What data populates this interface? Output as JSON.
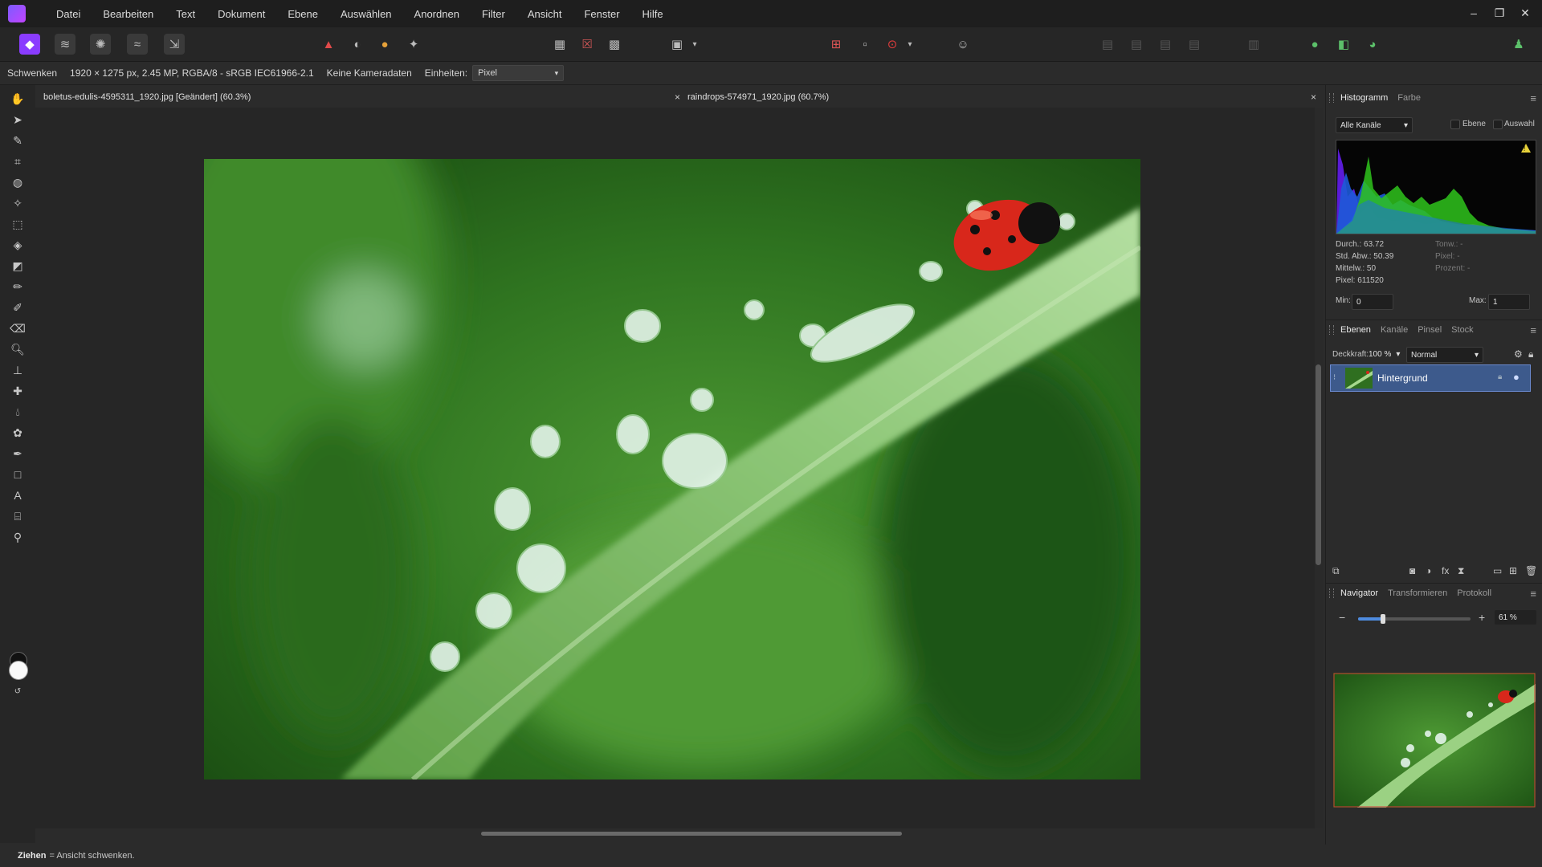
{
  "app": {
    "accent": "#8a3cff"
  },
  "menu": [
    "Datei",
    "Bearbeiten",
    "Text",
    "Dokument",
    "Ebene",
    "Auswählen",
    "Anordnen",
    "Filter",
    "Ansicht",
    "Fenster",
    "Hilfe"
  ],
  "window_controls": {
    "minimize": "–",
    "restore": "❐",
    "close": "✕"
  },
  "context": {
    "tool_name": "Schwenken",
    "doc_info": "1920 × 1275 px, 2.45 MP, RGBA/8 - sRGB IEC61966-2.1",
    "camera": "Keine Kameradaten",
    "units_label": "Einheiten:",
    "units_value": "Pixel"
  },
  "tabs": [
    {
      "title": "boletus-edulis-4595311_1920.jpg [Geändert] (60.3%)",
      "close": "×"
    },
    {
      "title": "raindrops-574971_1920.jpg (60.7%)",
      "close": "×"
    }
  ],
  "status": {
    "key": "Ziehen",
    "text": "= Ansicht schwenken."
  },
  "histogram_panel": {
    "tabs": [
      "Histogramm",
      "Farbe"
    ],
    "channel_select": "Alle Kanäle",
    "check_layer": "Ebene",
    "check_selection": "Auswahl",
    "warning": "!",
    "stats_left": [
      "Durch.: 63.72",
      "Std. Abw.: 50.39",
      "Mittelw.: 50",
      "Pixel: 611520"
    ],
    "stats_right": [
      "Tonw.: -",
      "Pixel: -",
      "Prozent: -"
    ],
    "min_label": "Min:",
    "min_value": "0",
    "max_label": "Max:",
    "max_value": "1"
  },
  "layers_panel": {
    "tabs": [
      "Ebenen",
      "Kanäle",
      "Pinsel",
      "Stock"
    ],
    "opacity_label": "Deckkraft:",
    "opacity_value": "100 %",
    "blend_mode": "Normal",
    "layer_name": "Hintergrund"
  },
  "navigator_panel": {
    "tabs": [
      "Navigator",
      "Transformieren",
      "Protokoll"
    ],
    "zoom_value": "61 %",
    "zoom_fraction": 0.22
  }
}
